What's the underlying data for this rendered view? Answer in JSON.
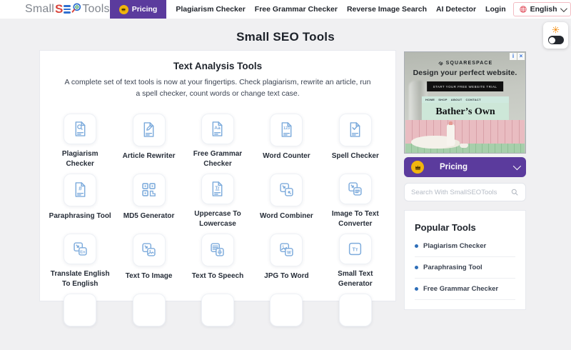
{
  "header": {
    "logo": {
      "prefix": "Small",
      "s": "S",
      "suffix": "Tools"
    },
    "pricing_label": "Pricing",
    "nav_items": [
      "Plagiarism Checker",
      "Free Grammar Checker",
      "Reverse Image Search",
      "AI Detector",
      "Login"
    ],
    "language": "English"
  },
  "page_title": "Small SEO Tools",
  "main": {
    "section_title": "Text Analysis Tools",
    "section_description": "A complete set of text tools is now at your fingertips. Check plagiarism, rewrite an article, run a spell checker, count words or change text case.",
    "tools": [
      {
        "label": "Plagiarism Checker",
        "icon": "doc-search"
      },
      {
        "label": "Article Rewriter",
        "icon": "doc-pencil"
      },
      {
        "label": "Free Grammar Checker",
        "icon": "doc-aa"
      },
      {
        "label": "Word Counter",
        "icon": "doc-123"
      },
      {
        "label": "Spell Checker",
        "icon": "doc-check"
      },
      {
        "label": "Paraphrasing Tool",
        "icon": "doc-hash"
      },
      {
        "label": "MD5 Generator",
        "icon": "qr-grid"
      },
      {
        "label": "Uppercase To Lowercase",
        "icon": "doc-tr"
      },
      {
        "label": "Word Combiner",
        "icon": "squares-combine"
      },
      {
        "label": "Image To Text Converter",
        "icon": "squares-text"
      },
      {
        "label": "Translate English To English",
        "icon": "squares-en"
      },
      {
        "label": "Text To Image",
        "icon": "squares-image"
      },
      {
        "label": "Text To Speech",
        "icon": "squares-mic"
      },
      {
        "label": "JPG To Word",
        "icon": "squares-w"
      },
      {
        "label": "Small Text Generator",
        "icon": "square-tt"
      },
      {
        "label": "",
        "icon": "blank"
      },
      {
        "label": "",
        "icon": "blank"
      },
      {
        "label": "",
        "icon": "blank"
      },
      {
        "label": "",
        "icon": "blank"
      },
      {
        "label": "",
        "icon": "blank"
      }
    ]
  },
  "sidebar": {
    "ad": {
      "brand": "SQUARESPACE",
      "headline": "Design your perfect website.",
      "cta": "START YOUR FREE WEBSITE TRIAL",
      "mini_nav": [
        "HOME",
        "SHOP",
        "ABOUT",
        "CONTACT"
      ],
      "mini_title": "Bather’s Own",
      "info_glyph": "i",
      "close_glyph": "×"
    },
    "pricing_label": "Pricing",
    "search_placeholder": "Search With SmallSEOTools",
    "popular": {
      "title": "Popular Tools",
      "items": [
        "Plagiarism Checker",
        "Paraphrasing Tool",
        "Free Grammar Checker"
      ]
    }
  },
  "colors": {
    "purple": "#5b3b9d",
    "crown_yellow": "#f0b50d",
    "icon_blue": "#7dabdc",
    "bullet_blue": "#2e6eb8",
    "logo_red": "#d9453c",
    "logo_blue": "#2f6fd0"
  }
}
